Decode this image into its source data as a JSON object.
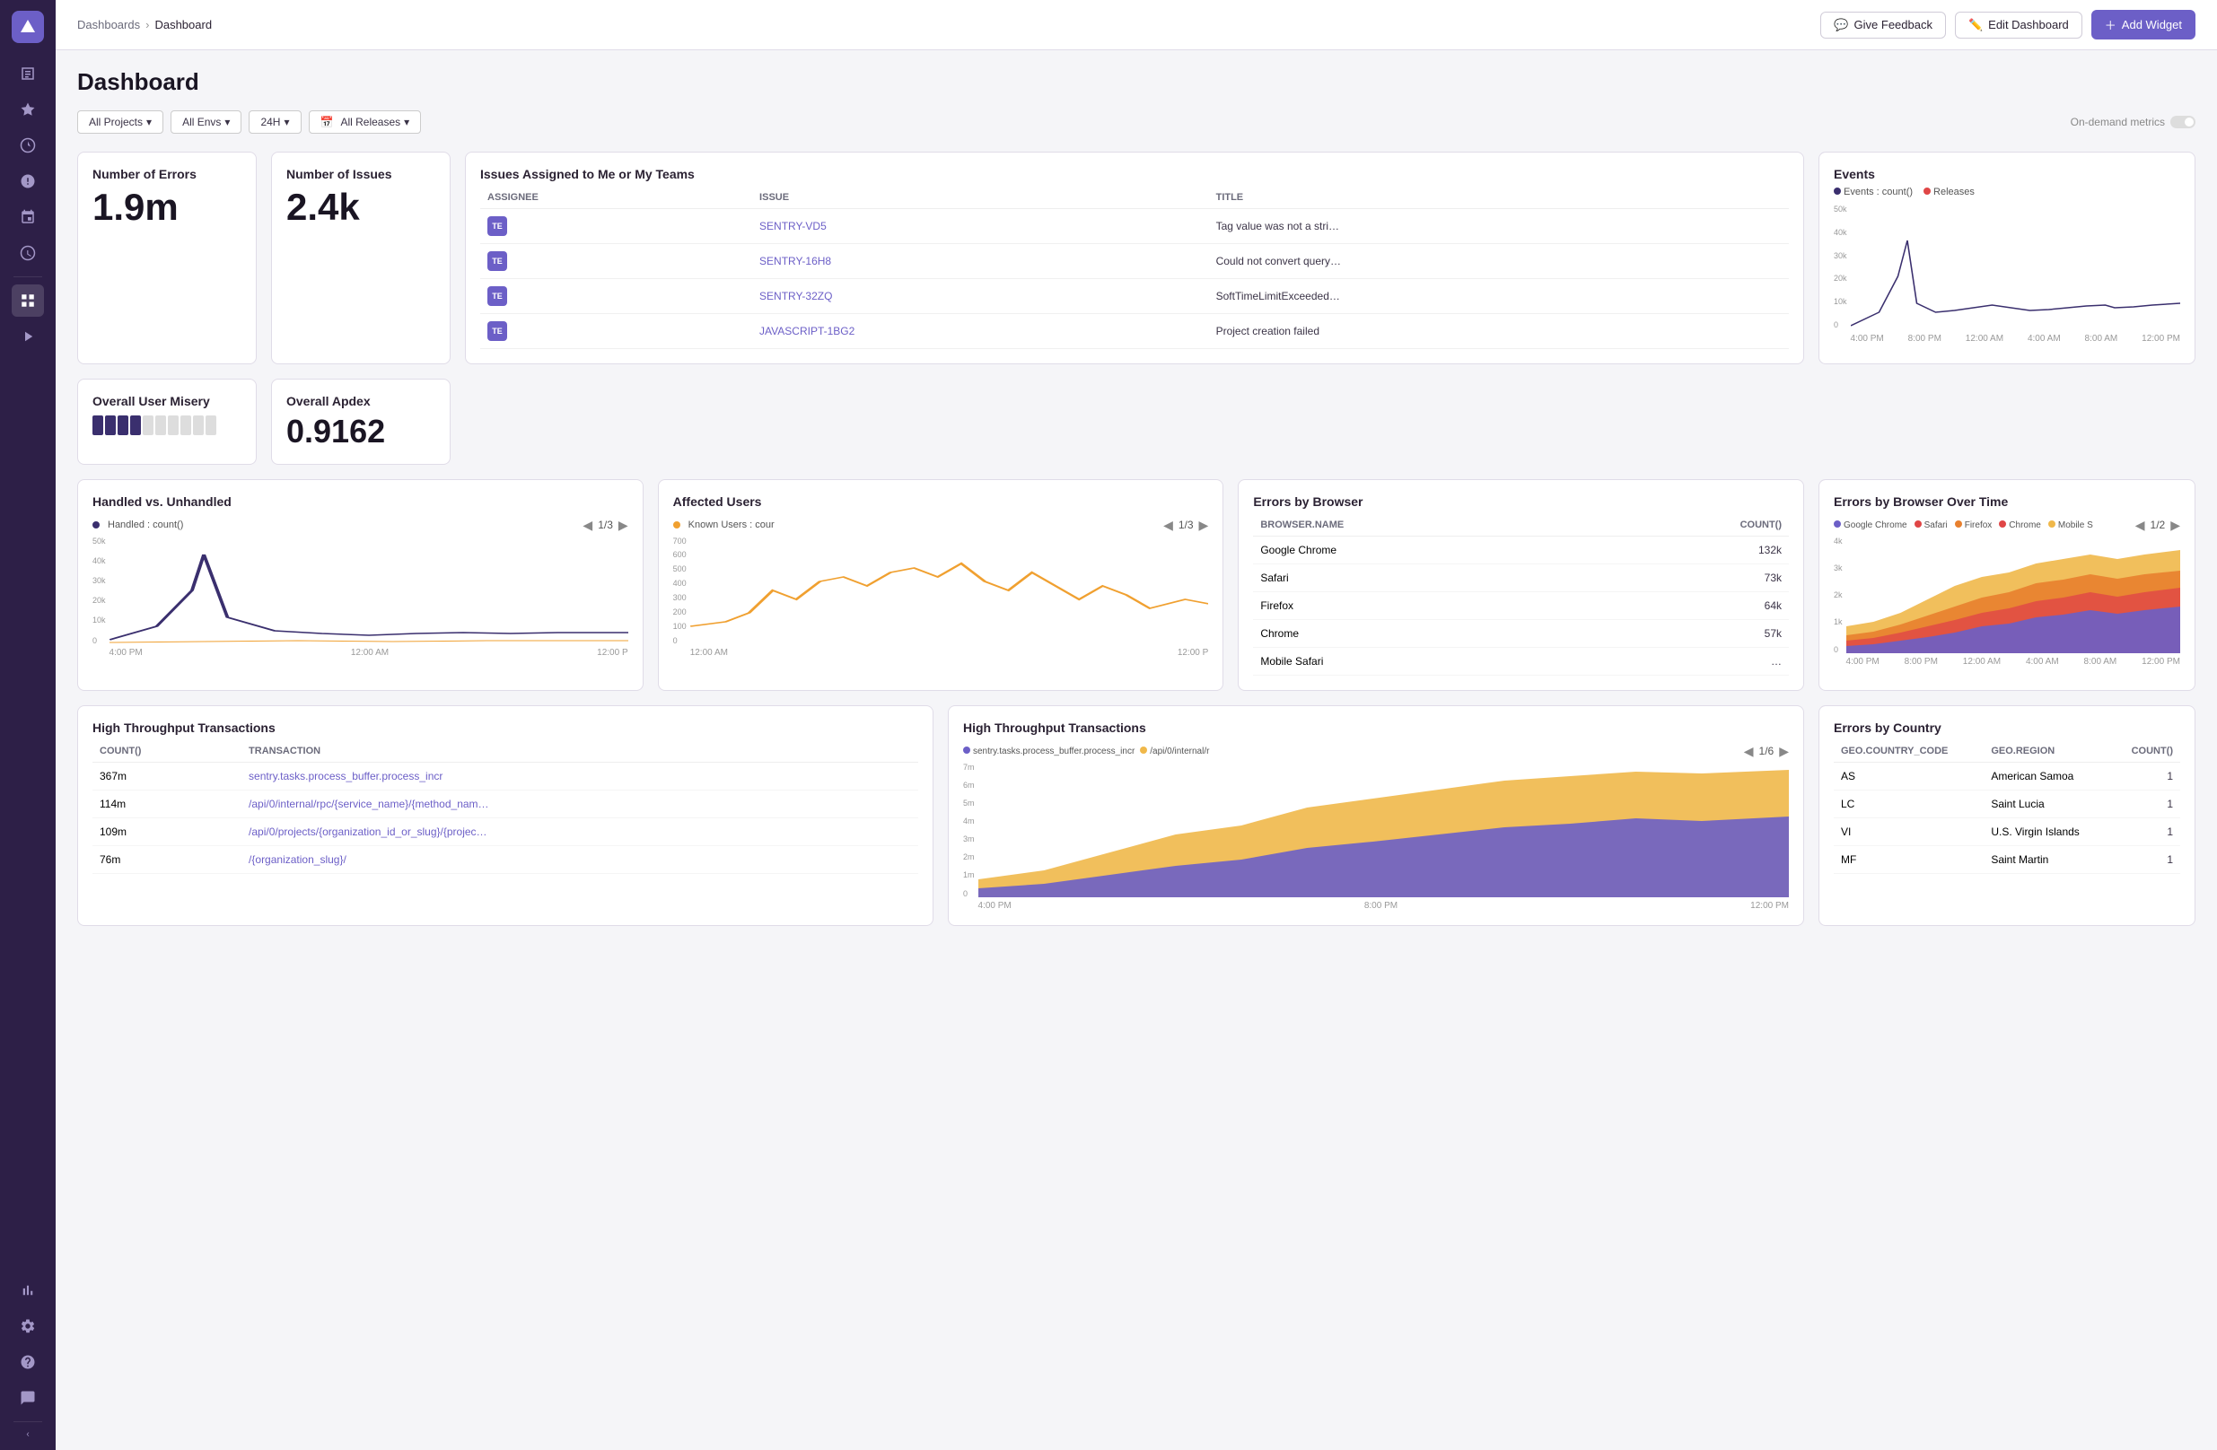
{
  "sidebar": {
    "items": [
      {
        "name": "issues-icon",
        "label": "Issues",
        "active": false
      },
      {
        "name": "performance-icon",
        "label": "Performance",
        "active": false
      },
      {
        "name": "discover-icon",
        "label": "Discover",
        "active": false
      },
      {
        "name": "alerts-icon",
        "label": "Alerts",
        "active": false
      },
      {
        "name": "releases-icon",
        "label": "Releases",
        "active": false
      },
      {
        "name": "monitor-icon",
        "label": "Crons",
        "active": false
      },
      {
        "name": "dashboard-icon",
        "label": "Dashboards",
        "active": true
      },
      {
        "name": "replay-icon",
        "label": "Replays",
        "active": false
      },
      {
        "name": "stats-icon",
        "label": "Stats",
        "active": false
      },
      {
        "name": "settings-icon",
        "label": "Settings",
        "active": false
      }
    ]
  },
  "header": {
    "breadcrumb": {
      "parent": "Dashboards",
      "current": "Dashboard"
    },
    "actions": {
      "feedback": "Give Feedback",
      "edit": "Edit Dashboard",
      "add": "Add Widget"
    }
  },
  "page": {
    "title": "Dashboard",
    "filters": {
      "projects": "All Projects",
      "envs": "All Envs",
      "time": "24H",
      "releases": "All Releases",
      "on_demand": "On-demand metrics"
    }
  },
  "widgets": {
    "number_of_errors": {
      "title": "Number of Errors",
      "value": "1.9m"
    },
    "number_of_issues": {
      "title": "Number of Issues",
      "value": "2.4k"
    },
    "user_misery": {
      "title": "Overall User Misery"
    },
    "apdex": {
      "title": "Overall Apdex",
      "value": "0.9162"
    },
    "issues_assigned": {
      "title": "Issues Assigned to Me or My Teams",
      "columns": [
        "ASSIGNEE",
        "ISSUE",
        "TITLE"
      ],
      "rows": [
        {
          "assignee": "TE",
          "issue": "SENTRY-VD5",
          "title": "Tag value was not a stri…"
        },
        {
          "assignee": "TE",
          "issue": "SENTRY-16H8",
          "title": "Could not convert query…"
        },
        {
          "assignee": "TE",
          "issue": "SENTRY-32ZQ",
          "title": "SoftTimeLimitExceeded…"
        },
        {
          "assignee": "TE",
          "issue": "JAVASCRIPT-1BG2",
          "title": "Project creation failed"
        }
      ]
    },
    "events": {
      "title": "Events",
      "legend": [
        {
          "label": "Events : count()",
          "color": "#3a2f6e"
        },
        {
          "label": "Releases",
          "color": "#e04646"
        }
      ],
      "y_labels": [
        "50k",
        "40k",
        "30k",
        "20k",
        "10k",
        "0"
      ],
      "x_labels": [
        "4:00 PM",
        "8:00 PM",
        "12:00 AM",
        "4:00 AM",
        "8:00 AM",
        "12:00 PM"
      ]
    },
    "handled_vs_unhandled": {
      "title": "Handled vs. Unhandled",
      "legend": "Handled : count()",
      "pagination": "1/3",
      "y_labels": [
        "50k",
        "40k",
        "30k",
        "20k",
        "10k",
        "0"
      ],
      "x_labels": [
        "4:00 PM",
        "12:00 AM",
        "12:00 P"
      ]
    },
    "affected_users": {
      "title": "Affected Users",
      "legend": "Known Users : cour",
      "pagination": "1/3",
      "y_labels": [
        "700",
        "600",
        "500",
        "400",
        "300",
        "200",
        "100",
        "0"
      ],
      "x_labels": [
        "12:00 AM",
        "12:00 P"
      ]
    },
    "errors_by_browser": {
      "title": "Errors by Browser",
      "columns": [
        "BROWSER.NAME",
        "COUNT()"
      ],
      "rows": [
        {
          "name": "Google Chrome",
          "count": "132k"
        },
        {
          "name": "Safari",
          "count": "73k"
        },
        {
          "name": "Firefox",
          "count": "64k"
        },
        {
          "name": "Chrome",
          "count": "57k"
        },
        {
          "name": "Mobile Safari",
          "count": "…"
        }
      ]
    },
    "errors_by_browser_over_time": {
      "title": "Errors by Browser Over Time",
      "legend": [
        "Google Chrome",
        "Safari",
        "Firefox",
        "Chrome",
        "Mobile S"
      ],
      "legend_colors": [
        "#6c5fc7",
        "#e04646",
        "#e8802e",
        "#e04646",
        "#f0b84a"
      ],
      "pagination": "1/2",
      "y_labels": [
        "4k",
        "3k",
        "2k",
        "1k",
        "0"
      ],
      "x_labels": [
        "4:00 PM",
        "8:00 PM",
        "12:00 AM",
        "4:00 AM",
        "8:00 AM",
        "12:00 PM"
      ]
    },
    "high_throughput_table": {
      "title": "High Throughput Transactions",
      "columns": [
        "COUNT()",
        "TRANSACTION"
      ],
      "rows": [
        {
          "count": "367m",
          "transaction": "sentry.tasks.process_buffer.process_incr"
        },
        {
          "count": "114m",
          "transaction": "/api/0/internal/rpc/{service_name}/{method_nam…"
        },
        {
          "count": "109m",
          "transaction": "/api/0/projects/{organization_id_or_slug}/{projec…"
        },
        {
          "count": "76m",
          "transaction": "/{organization_slug}/"
        }
      ]
    },
    "high_throughput_chart": {
      "title": "High Throughput Transactions",
      "legend1": "sentry.tasks.process_buffer.process_incr",
      "legend2": "/api/0/internal/r",
      "pagination": "1/6",
      "y_labels": [
        "7m",
        "6m",
        "5m",
        "4m",
        "3m",
        "2m",
        "1m",
        "0"
      ],
      "x_labels": [
        "4:00 PM",
        "8:00 PM",
        "12:00 PM"
      ]
    },
    "errors_by_country": {
      "title": "Errors by Country",
      "columns": [
        "GEO.COUNTRY_CODE",
        "GEO.REGION",
        "COUNT()"
      ],
      "rows": [
        {
          "code": "AS",
          "region": "American Samoa",
          "count": "1"
        },
        {
          "code": "LC",
          "region": "Saint Lucia",
          "count": "1"
        },
        {
          "code": "VI",
          "region": "U.S. Virgin Islands",
          "count": "1"
        },
        {
          "code": "MF",
          "region": "Saint Martin",
          "count": "1"
        }
      ]
    }
  },
  "colors": {
    "sidebar_bg": "#2d1f47",
    "accent": "#6c5fc7",
    "primary_line": "#3a2f6e",
    "orange_line": "#f0a030",
    "yellow_fill": "#f0b84a",
    "purple_fill": "#6c5fc7"
  }
}
